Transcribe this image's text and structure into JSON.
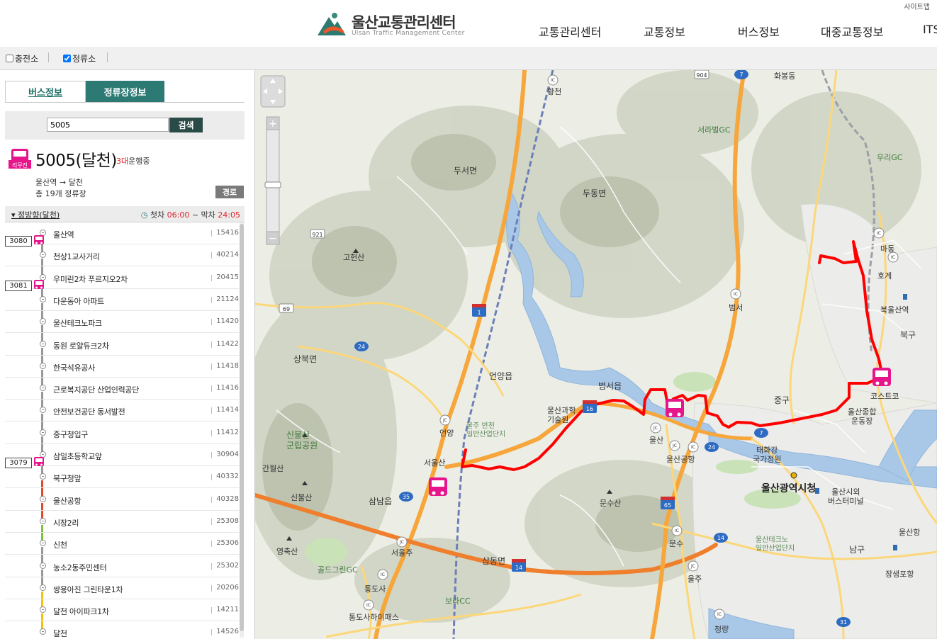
{
  "header": {
    "logo_kor": "울산교통관리센터",
    "logo_eng": "Ulsan Traffic Management Center",
    "sitemap": "사이트맵",
    "nav": [
      "교통관리센터",
      "교통정보",
      "버스정보",
      "대중교통정보",
      "ITS"
    ]
  },
  "toolbar": {
    "chk_charging": "충전소",
    "chk_charging_checked": false,
    "chk_stops": "정류소",
    "chk_stops_checked": true
  },
  "tabs": {
    "bus": "버스정보",
    "stop": "정류장정보"
  },
  "search": {
    "value": "5005",
    "button": "검색"
  },
  "bus": {
    "number": "5005(달천)",
    "running_count": "3대",
    "running_label": "운행중",
    "direction": "울산역 → 달천",
    "total_stops": "총 19개 정류장",
    "route_button": "경로",
    "icon_label": "리무진"
  },
  "direction_bar": {
    "label": "정방향(달천)",
    "first_label": "첫차",
    "first_time": "06:00",
    "sep": "~",
    "last_label": "막차",
    "last_time": "24:05"
  },
  "stops": [
    {
      "name": "울산역",
      "no": "15416",
      "plate": "3080"
    },
    {
      "name": "천상1교사거리",
      "no": "40214"
    },
    {
      "name": "우미린2차 푸르지오2차",
      "no": "20415",
      "plate": "3081"
    },
    {
      "name": "다운동아 아파트",
      "no": "21124"
    },
    {
      "name": "울산테크노파크",
      "no": "11420"
    },
    {
      "name": "동원 로얄듀크2차",
      "no": "11422"
    },
    {
      "name": "한국석유공사",
      "no": "11418"
    },
    {
      "name": "근로복지공단 산업인력공단",
      "no": "11416"
    },
    {
      "name": "안전보건공단 동서발전",
      "no": "11414"
    },
    {
      "name": "중구청입구",
      "no": "11412"
    },
    {
      "name": "삼일초등학교앞",
      "no": "30904",
      "plate": "3079"
    },
    {
      "name": "북구청앞",
      "no": "40332"
    },
    {
      "name": "울산공항",
      "no": "40328"
    },
    {
      "name": "시장2리",
      "no": "25308"
    },
    {
      "name": "신천",
      "no": "25306"
    },
    {
      "name": "농소2동주민센터",
      "no": "25302"
    },
    {
      "name": "쌍용아진 그린타운1차",
      "no": "20206"
    },
    {
      "name": "달천 아이파크1차",
      "no": "14211"
    },
    {
      "name": "달천",
      "no": "14526"
    }
  ],
  "line_colors": [
    "#999999",
    "#999999",
    "#999999",
    "#999999",
    "#999999",
    "#999999",
    "#999999",
    "#999999",
    "#999999",
    "#999999",
    "#999999",
    "#999999",
    "#e2492c",
    "#e2492c",
    "#7dc242",
    "#999999",
    "#999999",
    "#f4c20d",
    "#f4c20d"
  ],
  "map": {
    "labels": {
      "dooseo": "두서면",
      "dudong": "두동면",
      "gohyeonsan": "고헌산",
      "sangbuk": "상북면",
      "eonyangeup": "언양읍",
      "beomseoeup": "범서읍",
      "sinbulsan": "신불산\n군립공원",
      "ganwolsan": "간월산",
      "sinbulsan2": "신불산",
      "yeongchuksan": "영축산",
      "samnam": "삼남읍",
      "samdong": "삼동면",
      "munsusan": "문수산",
      "seoraebal": "서라벌GC",
      "woorigc": "우리GC",
      "madong": "마동",
      "hogye": "호계",
      "bukulsan": "북울산역",
      "bukgu": "북구",
      "junggu": "중구",
      "namgu": "남구",
      "cityhall": "울산광역시청",
      "bus_terminal": "울산시외\n버스터미널",
      "costco": "코스트코",
      "stadium": "울산종합\n운동장",
      "ulsanhang": "울산항",
      "jangsaengpo": "장생포항",
      "taehwa": "태화강\n국가정원",
      "goldgreen": "골드그린GC",
      "tongdosa": "통도사",
      "tongdosa_hp": "통도사하이패스",
      "boracc": "보라CC",
      "science": "울산과학\n기술원",
      "hwangcheon": "황천",
      "beomseo": "범서",
      "eonyang": "언양",
      "ulsan_ic": "울산",
      "seoulsan": "서울산",
      "seoulju": "서울주",
      "munsu": "문수",
      "ulju": "울주",
      "cheongryang": "청량",
      "ulsanhang2": "울산공항",
      "industrial": "울주 반천\n일반산업단지",
      "techno": "울산테크노\n일반산업단지",
      "hwajeong": "화봉동"
    },
    "route_color": "#ff0000"
  }
}
